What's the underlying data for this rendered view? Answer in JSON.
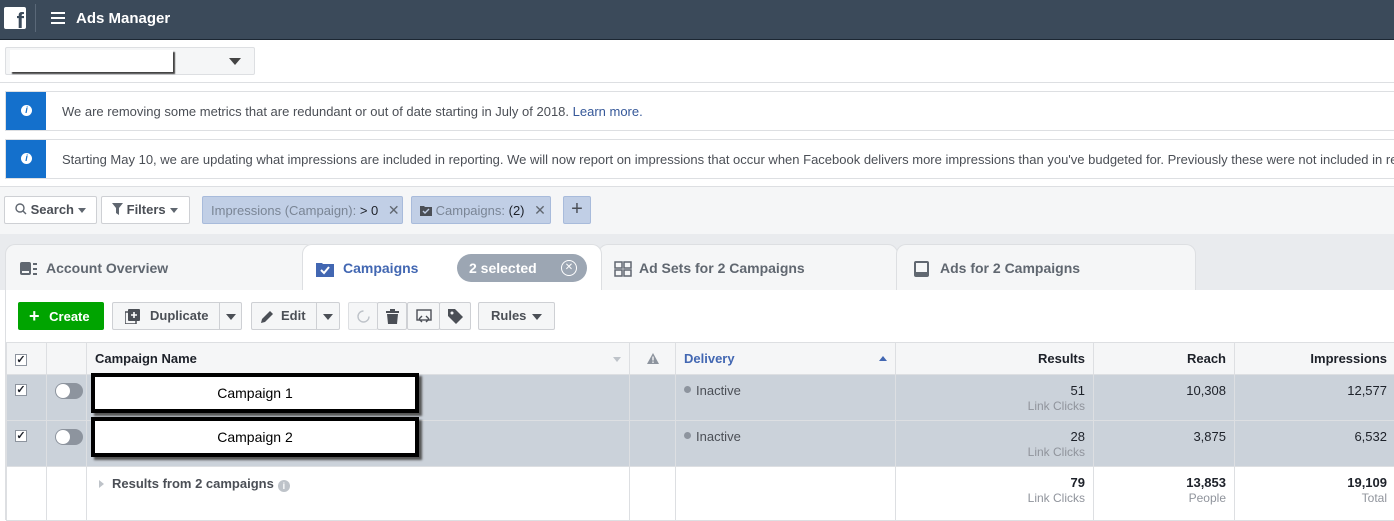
{
  "topbar": {
    "logo": "f",
    "title": "Ads Manager"
  },
  "account_selector": {
    "value": ""
  },
  "notices": [
    {
      "text": "We are removing some metrics that are redundant or out of date starting in July of 2018. ",
      "link": "Learn more."
    },
    {
      "text": "Starting May 10, we are updating what impressions are included in reporting. We will now report on impressions that occur when Facebook delivers more impressions than you've budgeted for. Previously these were not included in reporting."
    }
  ],
  "filterbar": {
    "search_label": "Search",
    "filters_label": "Filters",
    "chips": [
      {
        "label": "Impressions (Campaign):",
        "value": "> 0",
        "close": "✕"
      },
      {
        "label": "Campaigns:",
        "value": "(2)",
        "close": "✕"
      }
    ],
    "add_label": "+"
  },
  "tabs": [
    {
      "label": "Account Overview"
    },
    {
      "label": "Campaigns",
      "badge": "2 selected",
      "badge_close": "✕"
    },
    {
      "label": "Ad Sets for 2 Campaigns"
    },
    {
      "label": "Ads for 2 Campaigns"
    }
  ],
  "toolbar": {
    "create_label": "Create",
    "duplicate_label": "Duplicate",
    "edit_label": "Edit",
    "rules_label": "Rules"
  },
  "table": {
    "headers": {
      "name": "Campaign Name",
      "delivery": "Delivery",
      "results": "Results",
      "reach": "Reach",
      "impressions": "Impressions"
    },
    "rows": [
      {
        "name": "Campaign 1",
        "checked": "✓",
        "delivery": "Inactive",
        "results": "51",
        "results_type": "Link Clicks",
        "reach": "10,308",
        "impressions": "12,577"
      },
      {
        "name": "Campaign 2",
        "checked": "✓",
        "delivery": "Inactive",
        "results": "28",
        "results_type": "Link Clicks",
        "reach": "3,875",
        "impressions": "6,532"
      }
    ],
    "summary": {
      "label": "Results from 2 campaigns",
      "results": "79",
      "results_type": "Link Clicks",
      "reach": "13,853",
      "reach_type": "People",
      "impressions": "19,109",
      "impressions_type": "Total"
    },
    "header_checkbox": "✓"
  },
  "colors": {
    "topbar": "#3b4a5a",
    "accent": "#4267b2",
    "create": "#00a400",
    "info": "#1470cc",
    "selected_row": "#cbd2da"
  }
}
